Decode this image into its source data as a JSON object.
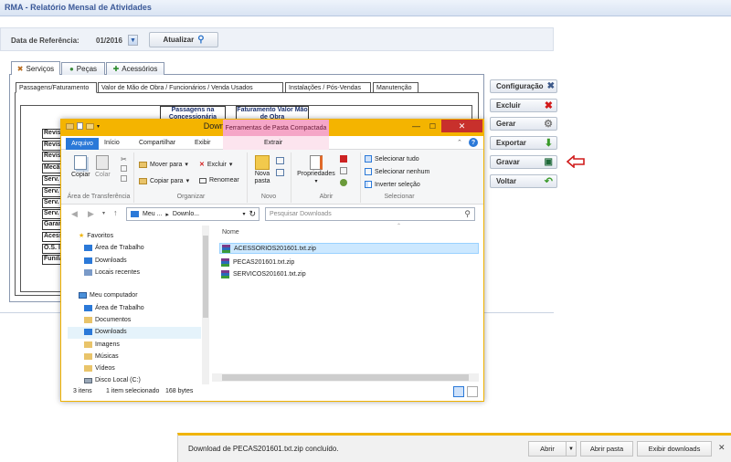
{
  "app": {
    "title": "RMA - Relatório Mensal de Atividades"
  },
  "ref": {
    "label": "Data de Referência:",
    "value": "01/2016",
    "update_label": "Atualizar"
  },
  "tabs": [
    {
      "label": "Serviços",
      "active": true
    },
    {
      "label": "Peças",
      "active": false
    },
    {
      "label": "Acessórios",
      "active": false
    }
  ],
  "subtabs": [
    "Passagens/Faturamento",
    "Valor de Mão de Obra / Funcionários / Venda Usados",
    "Instalações / Pós-Vendas",
    "Manutenção"
  ],
  "table_headers": [
    "Passagens na Concessionária",
    "Faturamento Valor Mão de Obra"
  ],
  "row_labels": [
    "Revis",
    "Revis",
    "Revis",
    "Mecâ",
    "Serv.",
    "Serv.",
    "Serv.",
    "Serv.",
    "Garan",
    "Acess",
    "O.S. I",
    "Funila"
  ],
  "actions": [
    {
      "label": "Configuração",
      "icon": "tools-icon"
    },
    {
      "label": "Excluir",
      "icon": "delete-x-icon"
    },
    {
      "label": "Gerar",
      "icon": "gear-icon"
    },
    {
      "label": "Exportar",
      "icon": "arrow-down-icon"
    },
    {
      "label": "Gravar",
      "icon": "save-icon"
    },
    {
      "label": "Voltar",
      "icon": "back-arrow-icon"
    }
  ],
  "explorer": {
    "title": "Downloads",
    "contextual_tab": "Ferramentas de Pasta Compactada",
    "ribbon_tabs": [
      "Arquivo",
      "Início",
      "Compartilhar",
      "Exibir",
      "Extrair"
    ],
    "clipboard": {
      "copy": "Copiar",
      "paste": "Colar",
      "group": "Área de Transferência"
    },
    "organize": {
      "move": "Mover para",
      "copy_to": "Copiar para",
      "delete": "Excluir",
      "rename": "Renomear",
      "group": "Organizar"
    },
    "new": {
      "folder": "Nova pasta",
      "group": "Novo"
    },
    "open": {
      "properties": "Propriedades",
      "group": "Abrir"
    },
    "select": {
      "all": "Selecionar tudo",
      "none": "Selecionar nenhum",
      "invert": "Inverter seleção",
      "group": "Selecionar"
    },
    "path": [
      "Meu ...",
      "Downlo..."
    ],
    "search_placeholder": "Pesquisar Downloads",
    "column_name": "Nome",
    "nav": {
      "favorites": "Favoritos",
      "fav_items": [
        "Área de Trabalho",
        "Downloads",
        "Locais recentes"
      ],
      "computer": "Meu computador",
      "pc_items": [
        "Área de Trabalho",
        "Documentos",
        "Downloads",
        "Imagens",
        "Músicas",
        "Vídeos",
        "Disco Local (C:)"
      ]
    },
    "files": [
      "ACESSORIOS201601.txt.zip",
      "PECAS201601.txt.zip",
      "SERVICOS201601.txt.zip"
    ],
    "status": {
      "count": "3 itens",
      "selected": "1 item selecionado",
      "size": "168 bytes"
    }
  },
  "download_bar": {
    "message": "Download de PECAS201601.txt.zip concluído.",
    "open": "Abrir",
    "open_folder": "Abrir pasta",
    "view": "Exibir downloads"
  }
}
